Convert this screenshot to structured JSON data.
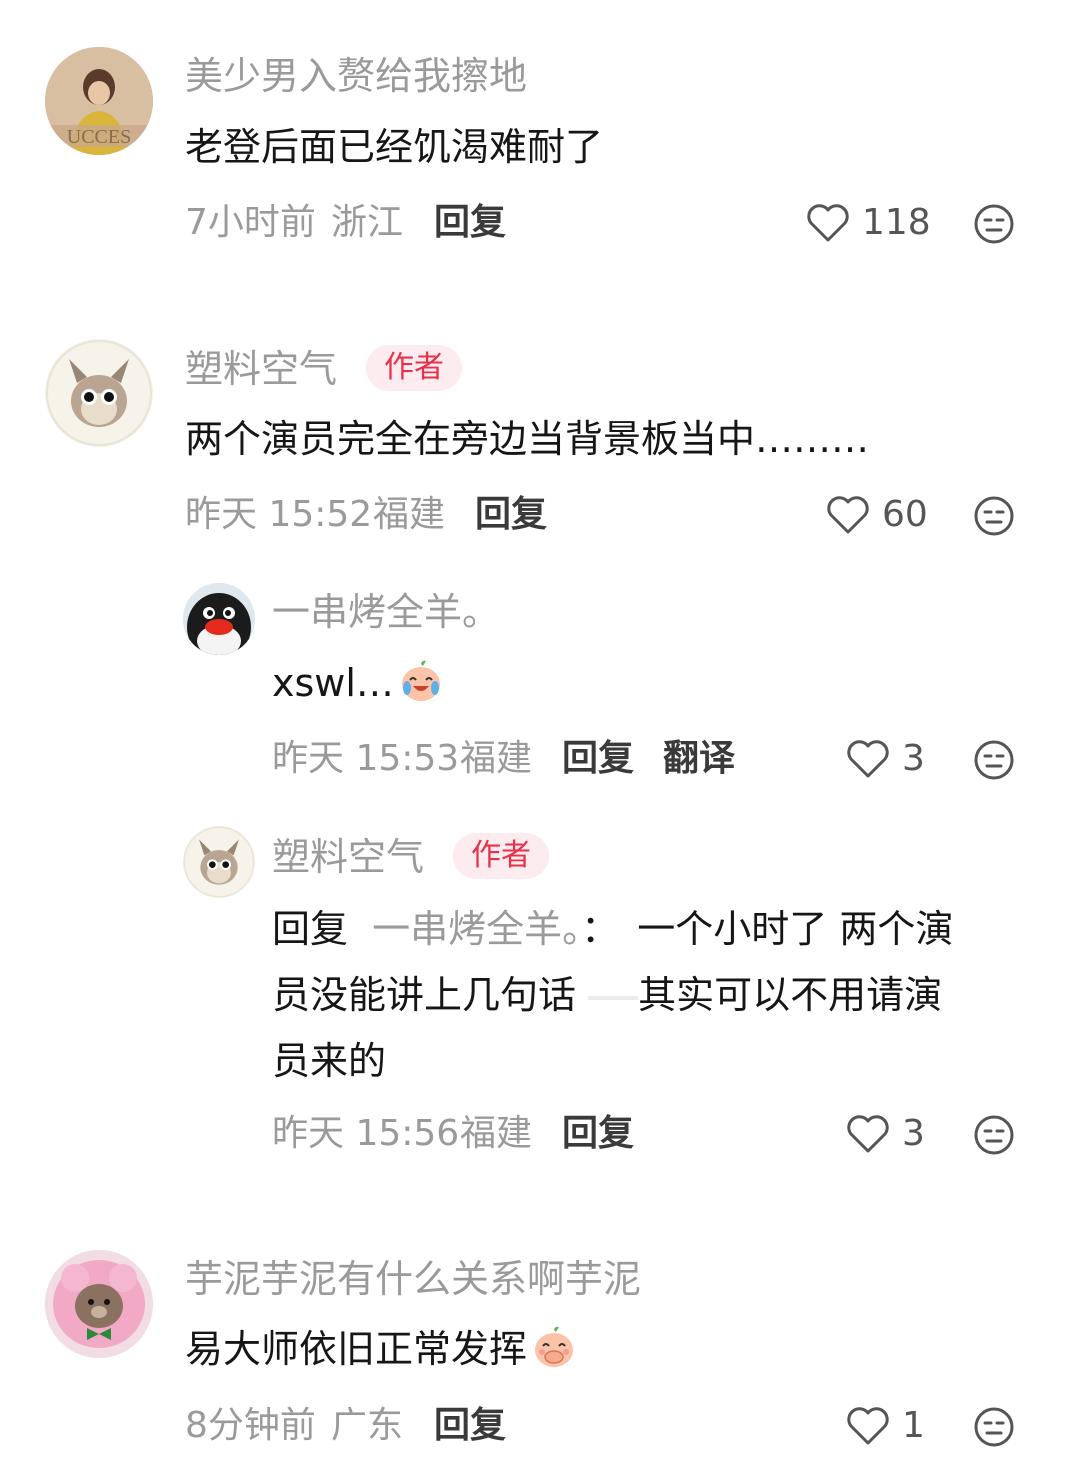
{
  "comments": [
    {
      "username": "美少男入赘给我擦地",
      "content": "老登后面已经饥渴难耐了",
      "time": "7小时前",
      "location": "浙江",
      "reply_label": "回复",
      "likes": "118"
    },
    {
      "username": "塑料空气",
      "badge": "作者",
      "content": "两个演员完全在旁边当背景板当中………",
      "time": "昨天 15:52",
      "location": "福建",
      "reply_label": "回复",
      "likes": "60",
      "replies": [
        {
          "username": "一串烤全羊。",
          "content": "xswl…",
          "emoji": "crying-laughing-peach-emoji",
          "time": "昨天 15:53",
          "location": "福建",
          "reply_label": "回复",
          "translate_label": "翻译",
          "likes": "3"
        },
        {
          "username": "塑料空气",
          "badge": "作者",
          "reply_prefix": "回复",
          "mention": "一串烤全羊。",
          "mention_suffix": "：",
          "line1": "一个小时了 两个演",
          "line2": "员没能讲上几句话",
          "line2b": "其实可以不用请演",
          "line3": "员来的",
          "time": "昨天 15:56",
          "location": "福建",
          "reply_label": "回复",
          "likes": "3"
        }
      ]
    },
    {
      "username": "芋泥芋泥有什么关系啊芋泥",
      "content": "易大师依旧正常发挥",
      "emoji": "covering-mouth-peach-emoji",
      "time": "8分钟前",
      "location": "广东",
      "reply_label": "回复",
      "likes": "1"
    }
  ],
  "icons": {
    "like": "heart-outline-icon",
    "dislike": "neutral-face-icon"
  },
  "colors": {
    "badge_bg": "#fdecef",
    "badge_text": "#e8304a",
    "meta_text": "#9a9a9a",
    "content_text": "#161616"
  }
}
